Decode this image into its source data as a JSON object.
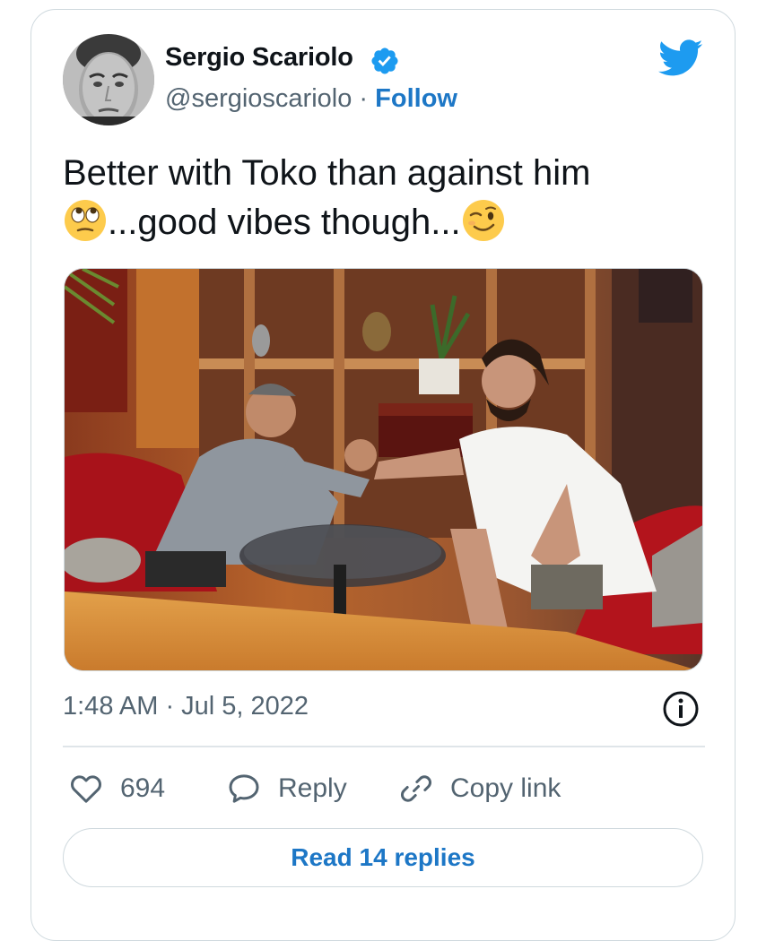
{
  "author": {
    "name": "Sergio Scariolo",
    "handle": "@sergioscariolo",
    "separator": "·",
    "follow_label": "Follow"
  },
  "tweet": {
    "line1": "Better with Toko than against him",
    "line2": "...good vibes though...",
    "emoji_1": "face-with-rolling-eyes",
    "emoji_2": "winking-face"
  },
  "timestamp": "1:48 AM · Jul 5, 2022",
  "actions": {
    "likes_count": "694",
    "reply_label": "Reply",
    "copy_link_label": "Copy link"
  },
  "read_replies_label": "Read 14 replies",
  "colors": {
    "link_blue": "#1d77c6",
    "twitter_blue": "#1d9bf0",
    "text_primary": "#0f1419",
    "text_secondary": "#536471",
    "border": "#cfd9de"
  }
}
